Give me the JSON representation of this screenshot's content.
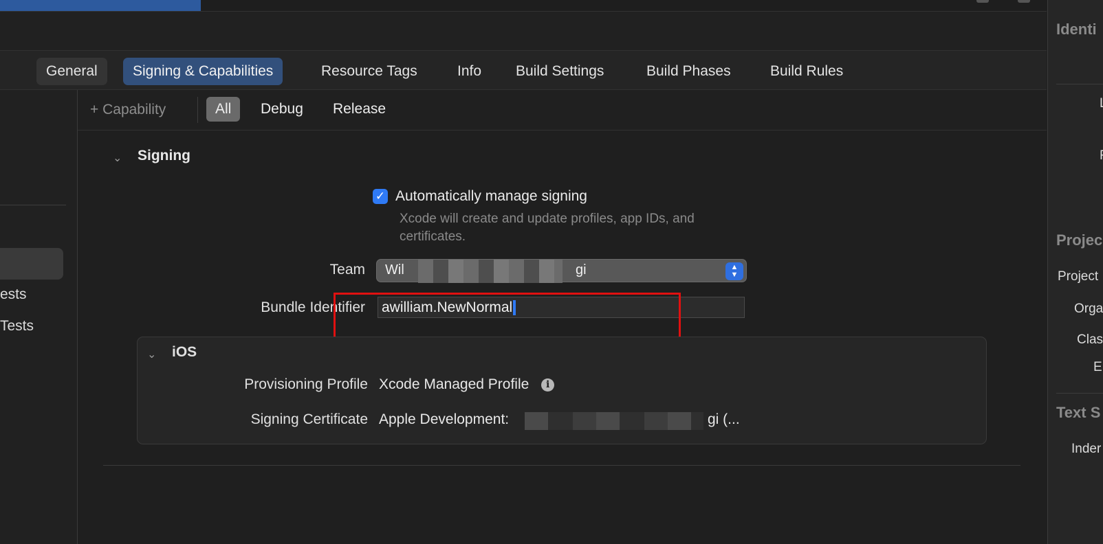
{
  "tabs": [
    "General",
    "Signing & Capabilities",
    "Resource Tags",
    "Info",
    "Build Settings",
    "Build Phases",
    "Build Rules"
  ],
  "selected_tab": "Signing & Capabilities",
  "capability_bar": {
    "add_capability_label": "+ Capability",
    "segments": [
      "All",
      "Debug",
      "Release"
    ],
    "selected_segment": "All"
  },
  "sidebar": {
    "items": [
      "ests",
      "Tests"
    ]
  },
  "signing": {
    "section_title": "Signing",
    "auto_manage_label": "Automatically manage signing",
    "auto_manage_checked": true,
    "auto_manage_note": "Xcode will create and update profiles, app IDs, and certificates.",
    "team_label": "Team",
    "team_value_visible": "Wil",
    "team_value_tail": "gi",
    "bundle_label": "Bundle Identifier",
    "bundle_value": "awilliam.NewNormal"
  },
  "ios": {
    "section_title": "iOS",
    "provisioning_label": "Provisioning Profile",
    "provisioning_value": "Xcode Managed Profile",
    "certificate_label": "Signing Certificate",
    "certificate_value_start": "Apple Development:",
    "certificate_value_end": "gi (..."
  },
  "inspector": {
    "headers": [
      "Identi",
      "Projec",
      "Text S"
    ],
    "labels": [
      "L",
      "F",
      "Project",
      "Orga",
      "Clas",
      "E",
      "Inder"
    ]
  },
  "colors": {
    "accent": "#2f7af5",
    "selected_tab_bg": "#32507c",
    "highlight_box": "#e01010"
  }
}
